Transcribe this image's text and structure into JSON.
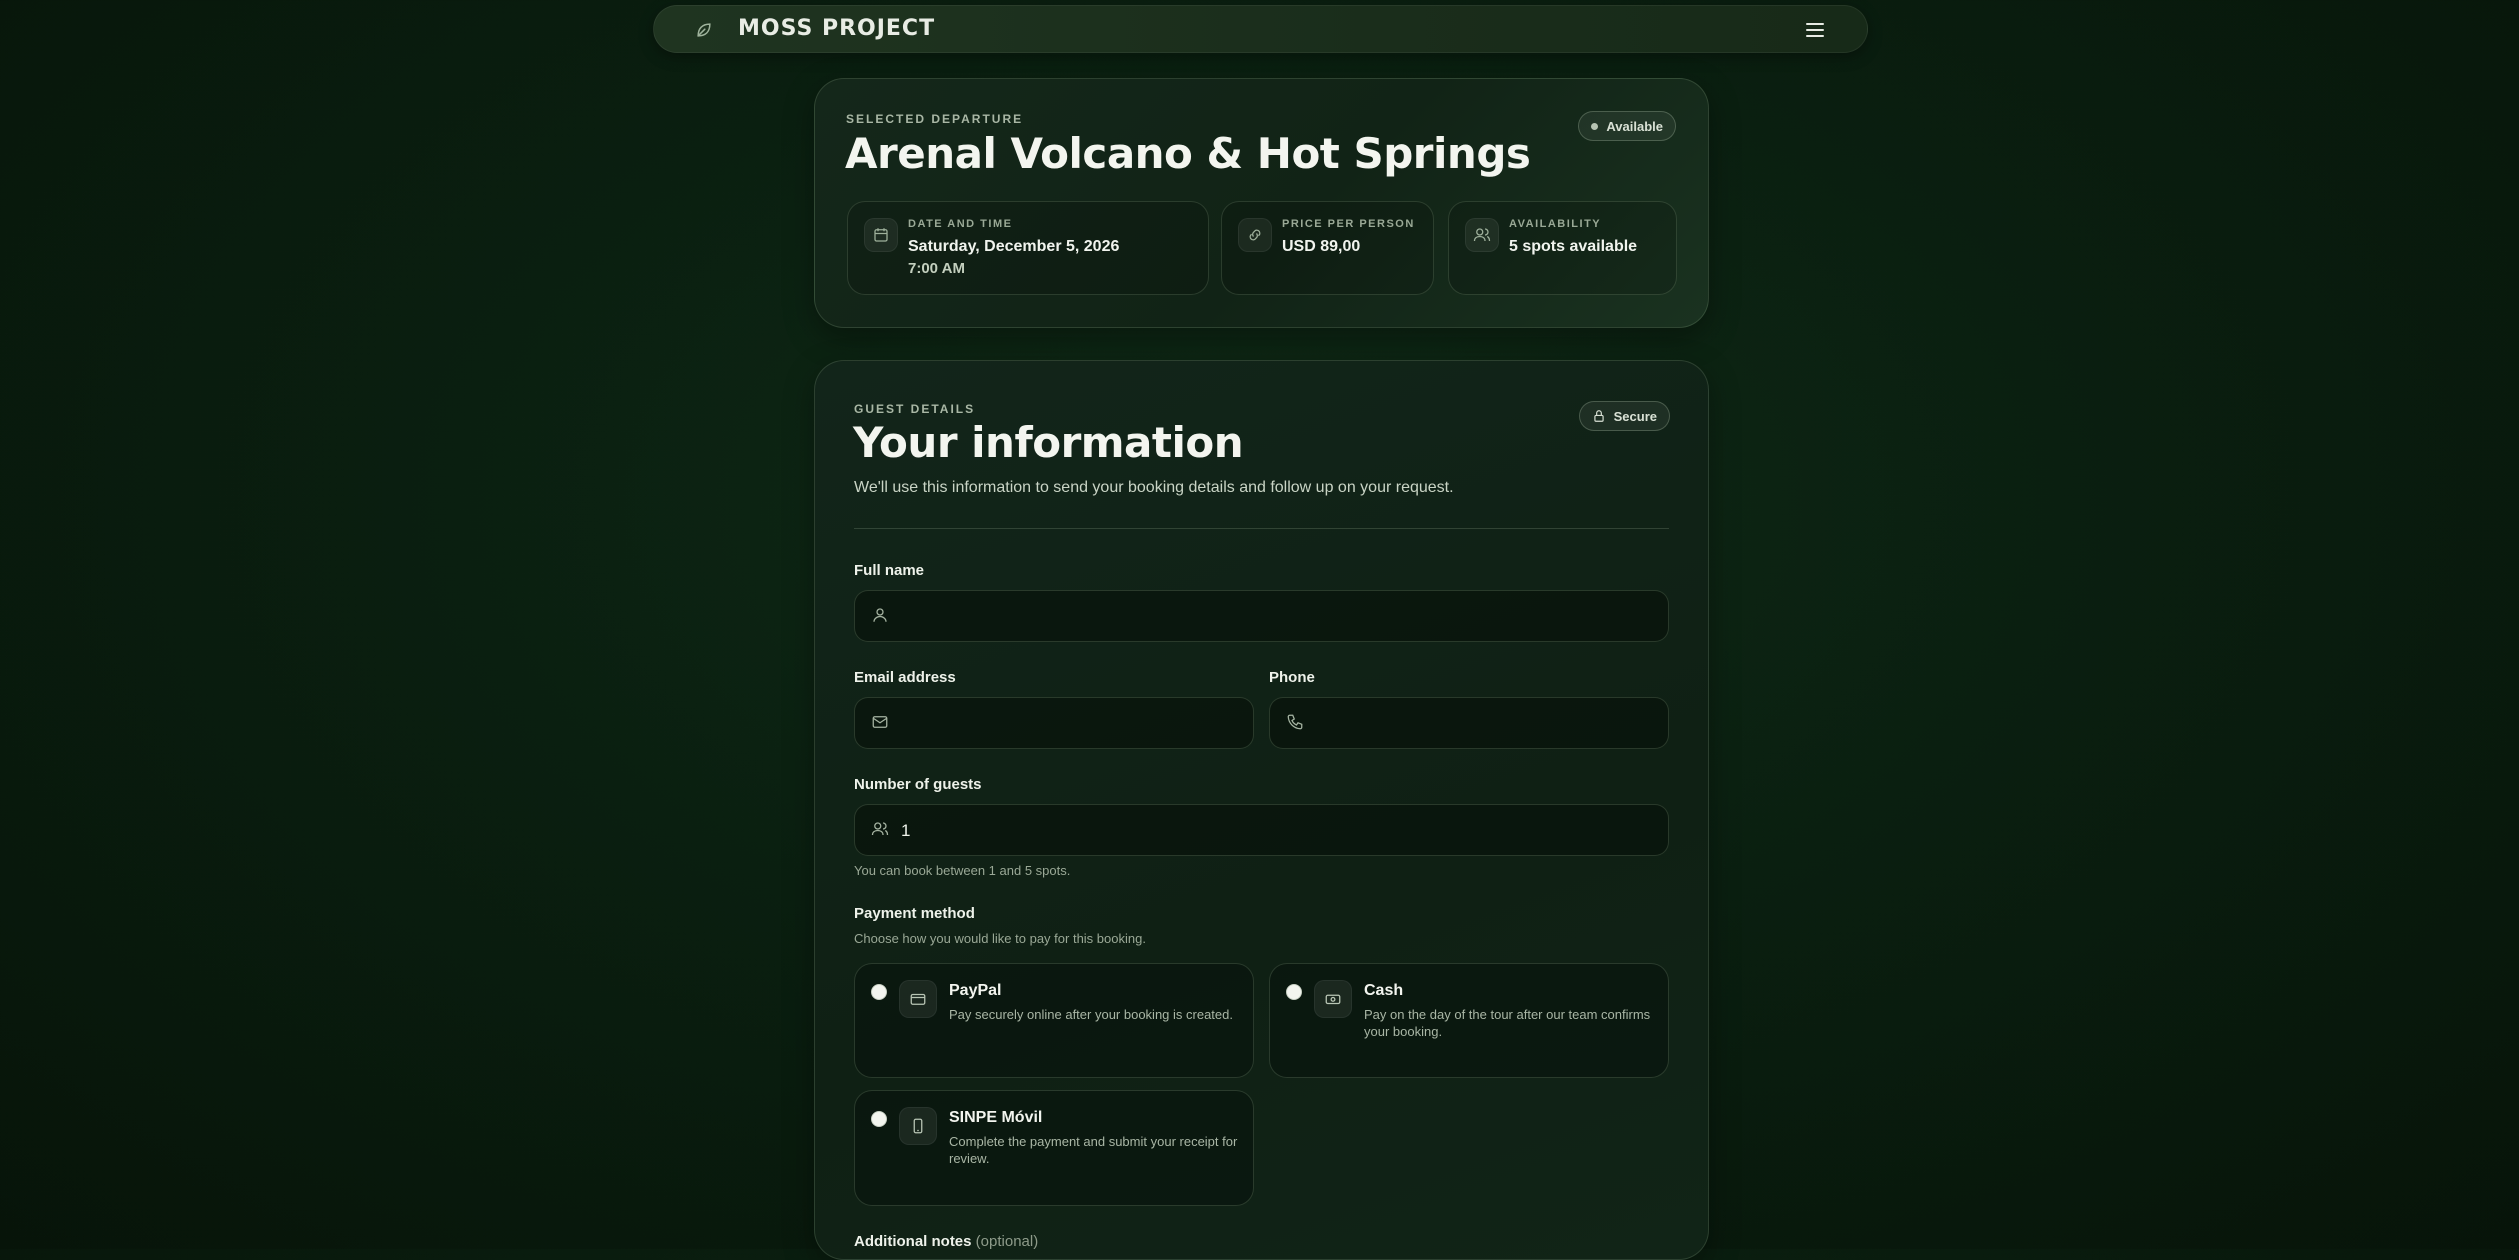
{
  "nav": {
    "brand": "MOSS PROJECT",
    "logo_icon": "leaf-icon",
    "menu_icon": "menu-icon"
  },
  "departure": {
    "eyebrow": "SELECTED DEPARTURE",
    "title": "Arenal Volcano & Hot Springs",
    "status": "Available",
    "date": {
      "label": "DATE AND TIME",
      "value": "Saturday, December 5, 2026",
      "time": "7:00 AM",
      "icon": "calendar-icon"
    },
    "price": {
      "label": "PRICE PER PERSON",
      "value": "USD 89,00",
      "icon": "tag-icon"
    },
    "availability": {
      "label": "AVAILABILITY",
      "value": "5 spots available",
      "icon": "users-icon"
    }
  },
  "guest": {
    "eyebrow": "GUEST DETAILS",
    "title": "Your information",
    "secure": "Secure",
    "subtitle": "We'll use this information to send your booking details and follow up on your request.",
    "full_name": {
      "label": "Full name",
      "value": ""
    },
    "email": {
      "label": "Email address",
      "value": ""
    },
    "phone": {
      "label": "Phone",
      "value": ""
    },
    "guests": {
      "label": "Number of guests",
      "value": "1",
      "hint": "You can book between 1 and 5 spots."
    },
    "payment": {
      "label": "Payment method",
      "hint": "Choose how you would like to pay for this booking.",
      "options": [
        {
          "title": "PayPal",
          "desc": "Pay securely online after your booking is created.",
          "icon": "credit-card-icon"
        },
        {
          "title": "Cash",
          "desc": "Pay on the day of the tour after our team confirms your booking.",
          "icon": "cash-icon"
        },
        {
          "title": "SINPE Móvil",
          "desc": "Complete the payment and submit your receipt for review.",
          "icon": "smartphone-icon"
        }
      ]
    },
    "notes": {
      "label": "Additional notes",
      "optional": "(optional)"
    }
  }
}
